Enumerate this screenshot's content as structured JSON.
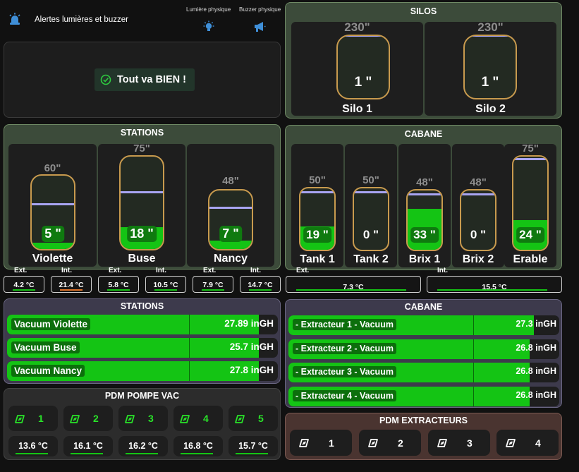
{
  "header": {
    "title": "Alertes lumières et buzzer",
    "light_label": "Lumière physique",
    "buzzer_label": "Buzzer physique"
  },
  "status": {
    "message": "Tout va BIEN !"
  },
  "silos": {
    "title": "SILOS",
    "tanks": [
      {
        "name": "Silo 1",
        "capacity": "230\"",
        "value": "1 \"",
        "fill": 0.0,
        "level": 0.985
      },
      {
        "name": "Silo 2",
        "capacity": "230\"",
        "value": "1 \"",
        "fill": 0.0,
        "level": 0.985
      }
    ]
  },
  "stations": {
    "title": "STATIONS",
    "tanks": [
      {
        "name": "Violette",
        "capacity": "60\"",
        "value": "5 \"",
        "fill": 0.083,
        "level": 0.6
      },
      {
        "name": "Buse",
        "capacity": "75\"",
        "value": "18 \"",
        "fill": 0.24,
        "level": 0.6
      },
      {
        "name": "Nancy",
        "capacity": "48\"",
        "value": "7 \"",
        "fill": 0.146,
        "level": 0.69
      }
    ],
    "temps": [
      {
        "label": "Ext.",
        "value": "4.2 °C",
        "warm": false
      },
      {
        "label": "Int.",
        "value": "21.4 °C",
        "warm": true
      },
      {
        "label": "Ext.",
        "value": "5.8 °C",
        "warm": false
      },
      {
        "label": "Int.",
        "value": "10.5 °C",
        "warm": false
      },
      {
        "label": "Ext.",
        "value": "7.9 °C",
        "warm": false
      },
      {
        "label": "Int.",
        "value": "14.7 °C",
        "warm": false
      }
    ]
  },
  "cabane": {
    "title": "CABANE",
    "tanks": [
      {
        "name": "Tank 1",
        "capacity": "50\"",
        "value": "19 \"",
        "fill": 0.38,
        "level": 0.92
      },
      {
        "name": "Tank 2",
        "capacity": "50\"",
        "value": "0 \"",
        "fill": 0.0,
        "level": 0.92
      },
      {
        "name": "Brix 1",
        "capacity": "48\"",
        "value": "33 \"",
        "fill": 0.6875,
        "level": 0.92
      },
      {
        "name": "Brix 2",
        "capacity": "48\"",
        "value": "0 \"",
        "fill": 0.0,
        "level": 0.92
      },
      {
        "name": "Erable",
        "capacity": "75\"",
        "value": "24 \"",
        "fill": 0.32,
        "level": 0.96
      }
    ],
    "temps": [
      {
        "label": "Ext.",
        "value": "7.3 °C"
      },
      {
        "label": "Int.",
        "value": "15.5 °C"
      }
    ]
  },
  "vacuum_stations": {
    "title": "STATIONS",
    "rows": [
      {
        "name": "Vacuum Violette",
        "value": "27.89 inGH",
        "fraction": 0.93
      },
      {
        "name": "Vacuum Buse",
        "value": "25.7 inGH",
        "fraction": 0.93
      },
      {
        "name": "Vacuum Nancy",
        "value": "27.8 inGH",
        "fraction": 0.93
      }
    ]
  },
  "vacuum_cabane": {
    "title": "CABANE",
    "rows": [
      {
        "name": "- Extracteur 1 - Vacuum",
        "value": "27.3 inGH",
        "fraction": 0.905
      },
      {
        "name": "- Extracteur 2 - Vacuum",
        "value": "26.8 inGH",
        "fraction": 0.89
      },
      {
        "name": "- Extracteur 3 - Vacuum",
        "value": "26.8 inGH",
        "fraction": 0.89
      },
      {
        "name": "- Extracteur 4 - Vacuum",
        "value": "26.8 inGH",
        "fraction": 0.89
      }
    ]
  },
  "pdm_pompe": {
    "title": "PDM POMPE VAC",
    "pumps": [
      "1",
      "2",
      "3",
      "4",
      "5"
    ],
    "temps": [
      "13.6 °C",
      "16.1 °C",
      "16.2 °C",
      "16.8 °C",
      "15.7 °C"
    ]
  },
  "pdm_extracteurs": {
    "title": "PDM EXTRACTEURS",
    "items": [
      "1",
      "2",
      "3",
      "4"
    ]
  },
  "colors": {
    "accent_green": "#14c414",
    "level_line": "#a8a4f2",
    "tank_border": "#c89a4e",
    "icon_blue": "#3f8fd8",
    "warn_orange": "#e0742a"
  }
}
